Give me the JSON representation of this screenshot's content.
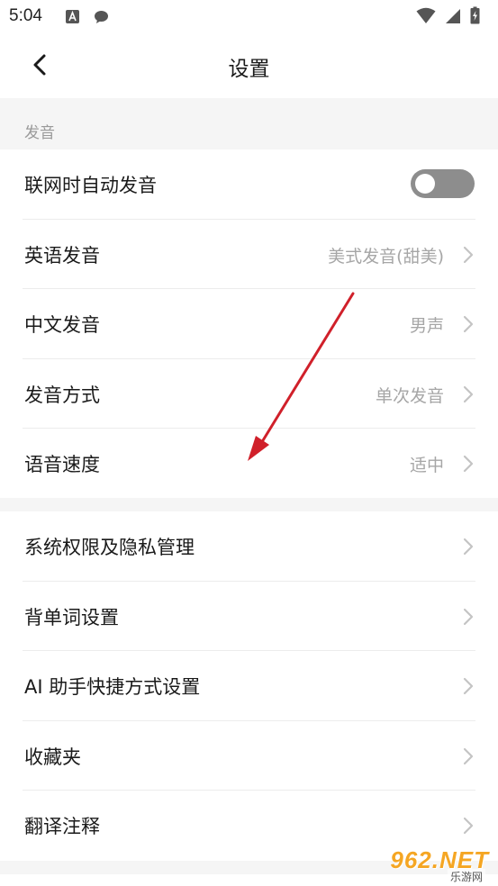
{
  "status_bar": {
    "time": "5:04"
  },
  "header": {
    "title": "设置"
  },
  "sections": {
    "pronunciation_header": "发音"
  },
  "pronunciation": {
    "auto_pronounce_label": "联网时自动发音",
    "auto_pronounce_on": false,
    "english_label": "英语发音",
    "english_value": "美式发音(甜美)",
    "chinese_label": "中文发音",
    "chinese_value": "男声",
    "mode_label": "发音方式",
    "mode_value": "单次发音",
    "speed_label": "语音速度",
    "speed_value": "适中"
  },
  "general": {
    "permissions_label": "系统权限及隐私管理",
    "word_settings_label": "背单词设置",
    "ai_shortcut_label": "AI 助手快捷方式设置",
    "favorites_label": "收藏夹",
    "translation_notes_label": "翻译注释"
  },
  "watermark": {
    "text": "962.NET",
    "subtext": "乐游网"
  },
  "colors": {
    "toggle_off": "#8d8d8d",
    "annotation_arrow": "#d0202a",
    "secondary_text": "#a6a6a6"
  }
}
